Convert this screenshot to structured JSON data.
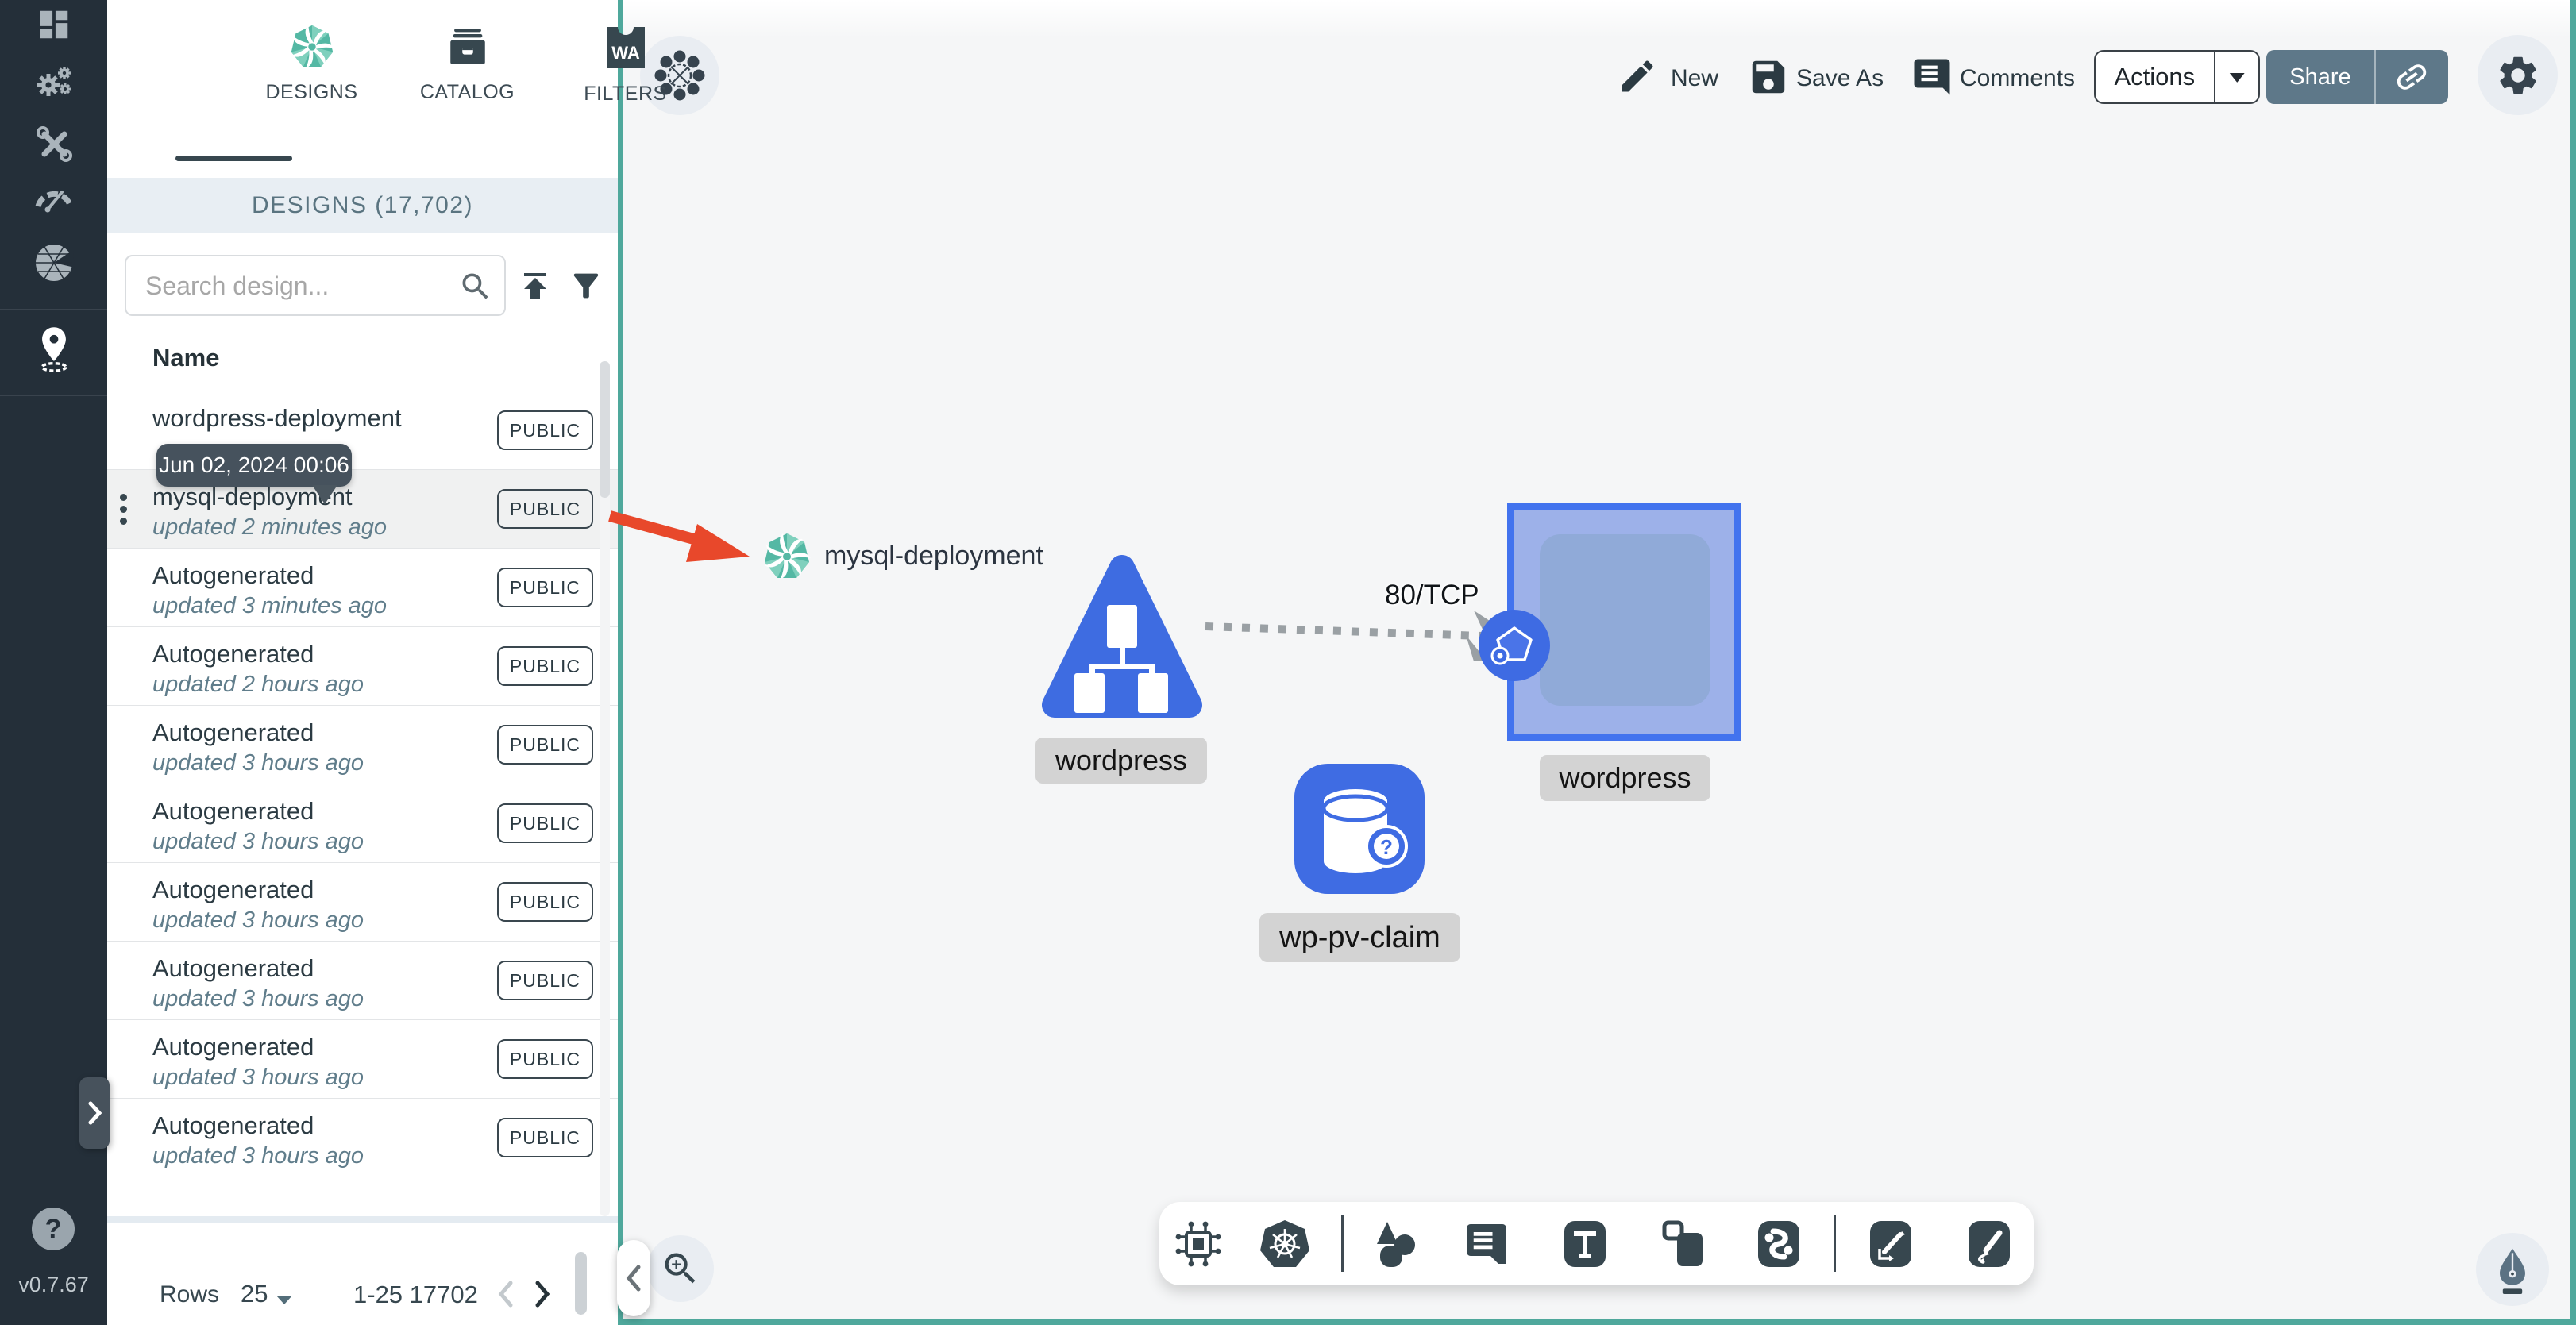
{
  "app": {
    "version": "v0.7.67"
  },
  "colors": {
    "accent_teal": "#4FA89C",
    "node_blue": "#3E6CE1",
    "selection_blue": "#4273EE",
    "arrow_red": "#E8482B",
    "sidebar_bg": "#242F39"
  },
  "panel": {
    "tabs": [
      {
        "label": "DESIGNS",
        "active": true
      },
      {
        "label": "CATALOG",
        "active": false
      },
      {
        "label": "FILTERS",
        "active": false
      }
    ],
    "header": "DESIGNS (17,702)",
    "search_placeholder": "Search design...",
    "column_name": "Name",
    "tooltip": "Jun 02, 2024 00:06",
    "rows": [
      {
        "name": "wordpress-deployment",
        "updated": "",
        "badge": "PUBLIC"
      },
      {
        "name": "mysql-deployment",
        "updated": "updated 2 minutes ago",
        "badge": "PUBLIC",
        "hover": true
      },
      {
        "name": "Autogenerated",
        "updated": "updated 3 minutes ago",
        "badge": "PUBLIC"
      },
      {
        "name": "Autogenerated",
        "updated": "updated 2 hours ago",
        "badge": "PUBLIC"
      },
      {
        "name": "Autogenerated",
        "updated": "updated 3 hours ago",
        "badge": "PUBLIC"
      },
      {
        "name": "Autogenerated",
        "updated": "updated 3 hours ago",
        "badge": "PUBLIC"
      },
      {
        "name": "Autogenerated",
        "updated": "updated 3 hours ago",
        "badge": "PUBLIC"
      },
      {
        "name": "Autogenerated",
        "updated": "updated 3 hours ago",
        "badge": "PUBLIC"
      },
      {
        "name": "Autogenerated",
        "updated": "updated 3 hours ago",
        "badge": "PUBLIC"
      },
      {
        "name": "Autogenerated",
        "updated": "updated 3 hours ago",
        "badge": "PUBLIC"
      }
    ],
    "pagination": {
      "rows_label": "Rows",
      "page_size": "25",
      "range": "1-25 17702"
    }
  },
  "toolbar": {
    "new_label": "New",
    "save_as_label": "Save As",
    "comments_label": "Comments",
    "actions_label": "Actions",
    "share_label": "Share"
  },
  "canvas": {
    "drag_item_label": "mysql-deployment",
    "edge_label": "80/TCP",
    "deployment_label": "wordpress",
    "service_label": "wordpress",
    "pvc_label": "wp-pv-claim"
  }
}
